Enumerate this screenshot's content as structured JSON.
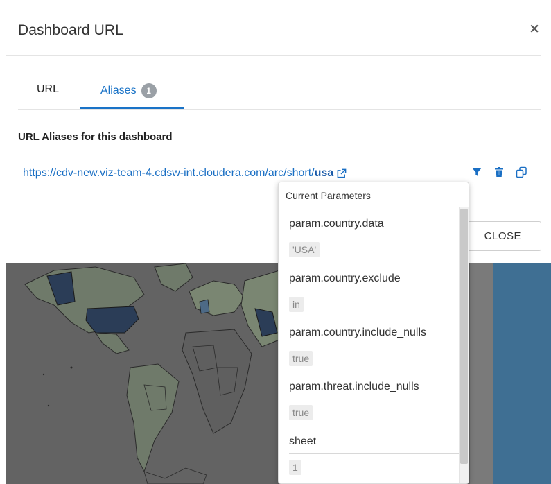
{
  "modal": {
    "title": "Dashboard URL",
    "close_symbol": "×"
  },
  "tabs": [
    {
      "label": "URL",
      "active": false
    },
    {
      "label": "Aliases",
      "active": true,
      "badge": "1"
    }
  ],
  "aliases": {
    "section_title": "URL Aliases for this dashboard",
    "url_prefix": "https://cdv-new.viz-team-4.cdsw-int.cloudera.com/arc/short/",
    "url_alias": "usa",
    "icons": [
      "external-link-icon",
      "filter-icon",
      "trash-icon",
      "copy-icon"
    ]
  },
  "footer": {
    "close_label": "CLOSE"
  },
  "popover": {
    "title": "Current Parameters",
    "params": [
      {
        "name": "param.country.data",
        "value": "'USA'"
      },
      {
        "name": "param.country.exclude",
        "value": "in"
      },
      {
        "name": "param.country.include_nulls",
        "value": "true"
      },
      {
        "name": "param.threat.include_nulls",
        "value": "true"
      },
      {
        "name": "sheet",
        "value": "1"
      }
    ]
  },
  "colors": {
    "accent": "#1a73c7",
    "map_background": "#636363",
    "map_highlight": "#263a55",
    "ocean_right": "#3f6f93"
  }
}
